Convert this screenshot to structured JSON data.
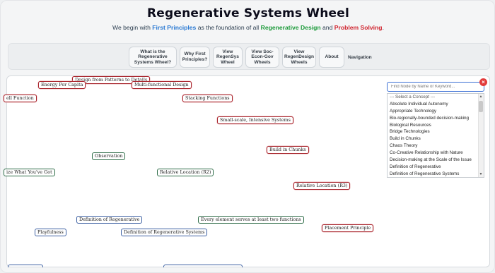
{
  "header": {
    "title": "Regenerative Systems Wheel",
    "subtitle": {
      "pre": "We begin with ",
      "kw1": "First Principles",
      "mid1": " as the foundation of all ",
      "kw2": "Regenerative Design",
      "mid2": " and ",
      "kw3": "Problem Solving",
      "post": "."
    }
  },
  "nav": {
    "items": [
      "What is the Regenerative Systems Wheel?",
      "Why First Principles?",
      "View RegenSys Wheel",
      "View Soc-Econ-Gov Wheels",
      "View RegenDesign Wheels",
      "About"
    ],
    "label": "Navigation"
  },
  "graph": {
    "nodes": [
      "Design from Patterns to Details",
      "Energy Per Capita",
      "Multi-functional Design",
      "ell Function",
      "Stacking Functions",
      "Small-scale, Intensive Systems",
      "Build in Chunks",
      "Observation",
      "ize What You've Got",
      "Relative Location (R2)",
      "Relative Location (R3)",
      "Definition of Regenerative",
      "Every element serves at least two functions",
      "Placement Principle",
      "Playfulness",
      "Definition of Regenerative Systems"
    ]
  },
  "search": {
    "placeholder": "Find Node by Name or Keyword...",
    "clear_icon": "×",
    "options": [
      "--- Select a Concept ---",
      "Absolute Individual Autonomy",
      "Appropriate Technology",
      "Bio-regionally-bounded decision-making",
      "Biological Resources",
      "Bridge Technologies",
      "Build in Chunks",
      "Chaos Theory",
      "Co-Creative Relationship with Nature",
      "Decision-making at the Scale of the Issue",
      "Definition of Regenerative",
      "Definition of Regenerative Systems"
    ]
  },
  "colors": {
    "accent_blue": "#2878d2",
    "accent_green": "#1c9a3a",
    "accent_red": "#d0242e",
    "node_red": "#a8232b",
    "node_green": "#2c6b46",
    "node_blue": "#3b5fa2"
  }
}
